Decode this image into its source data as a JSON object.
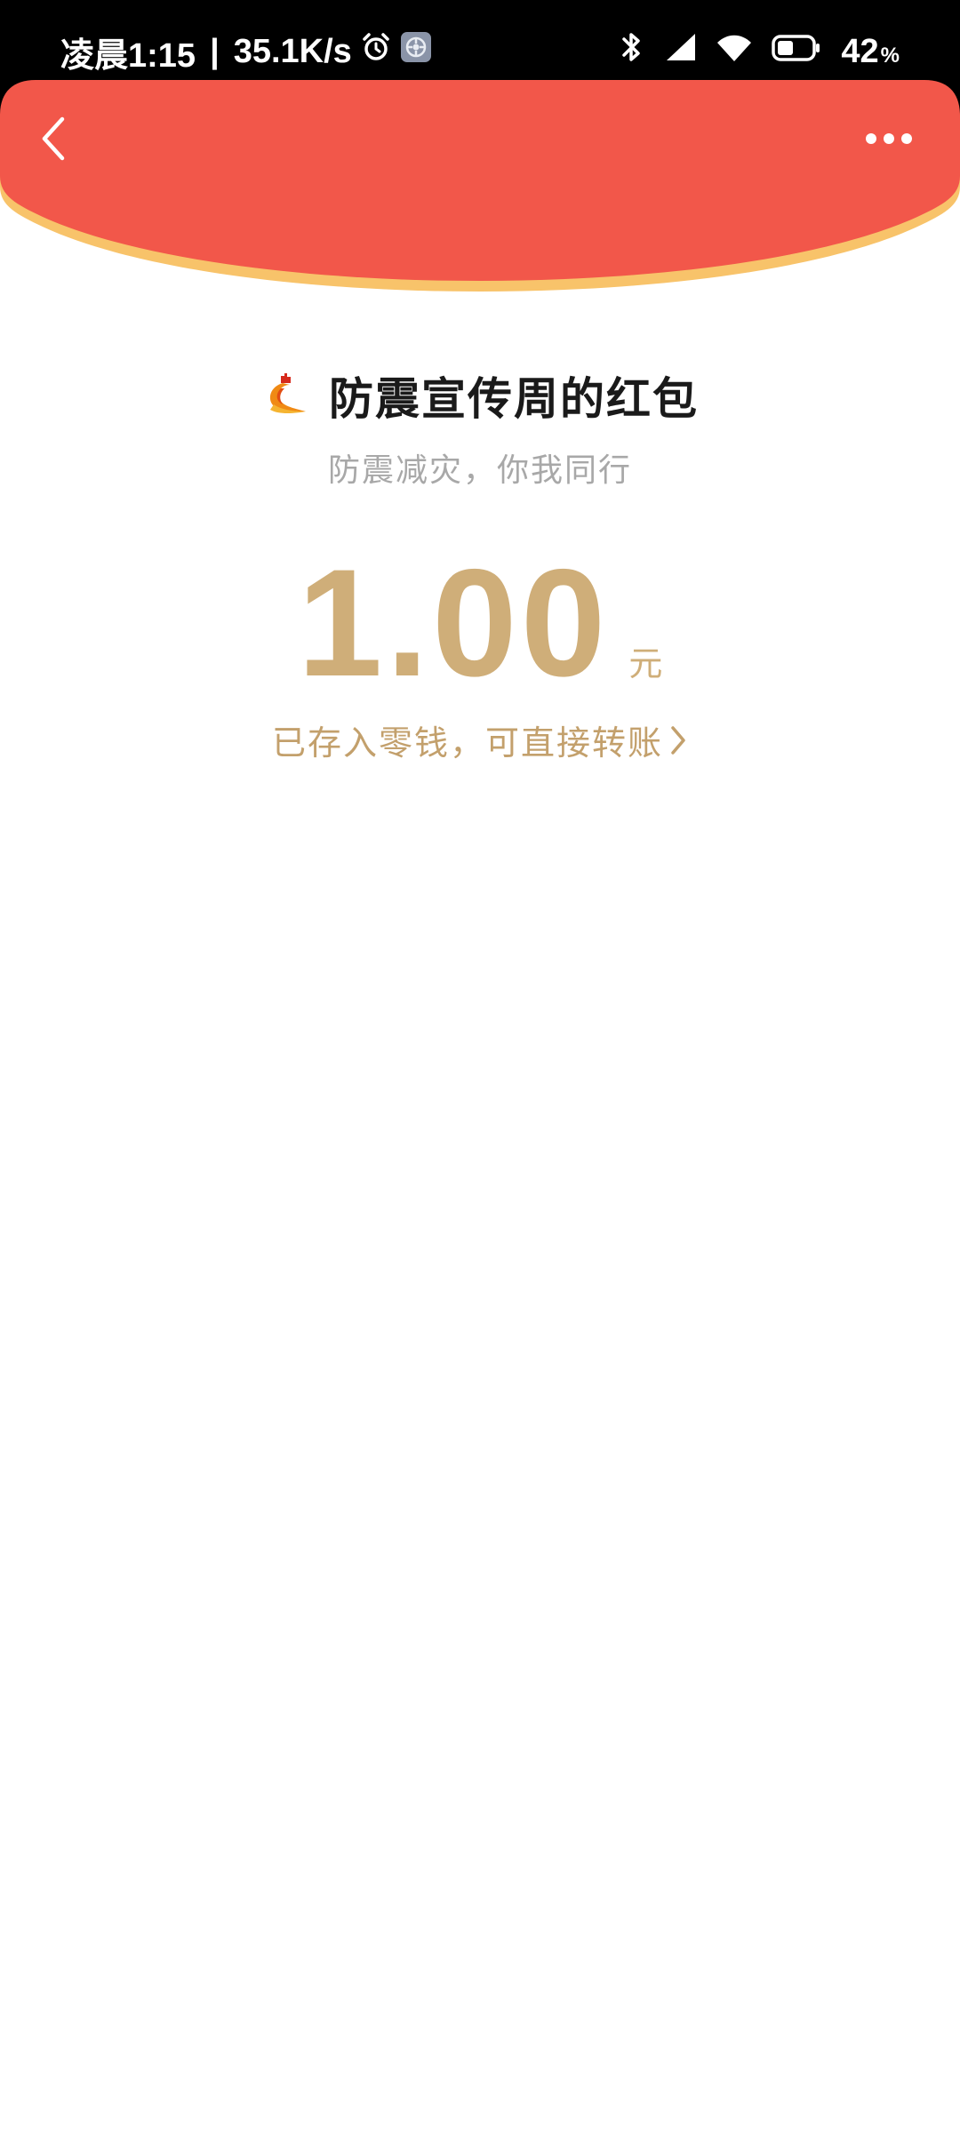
{
  "status_bar": {
    "time": "凌晨1:15",
    "separator": "|",
    "net_speed": "35.1K/s",
    "battery_level": "42",
    "battery_unit": "%",
    "icons": [
      "alarm-icon",
      "settings-app-icon",
      "bluetooth-icon",
      "cellular-signal-icon",
      "wifi-icon",
      "battery-icon"
    ]
  },
  "header": {
    "color": "#F2574A",
    "border_color": "#F8C36A",
    "back_icon": "chevron-left-icon",
    "more_icon": "more-dots-icon"
  },
  "red_packet": {
    "sender": "防震宣传周的红包",
    "blessing": "防震减灾，你我同行",
    "amount": "1.00",
    "unit": "元",
    "status_text": "已存入零钱，可直接转账",
    "accent_color": "#CFAE79"
  }
}
